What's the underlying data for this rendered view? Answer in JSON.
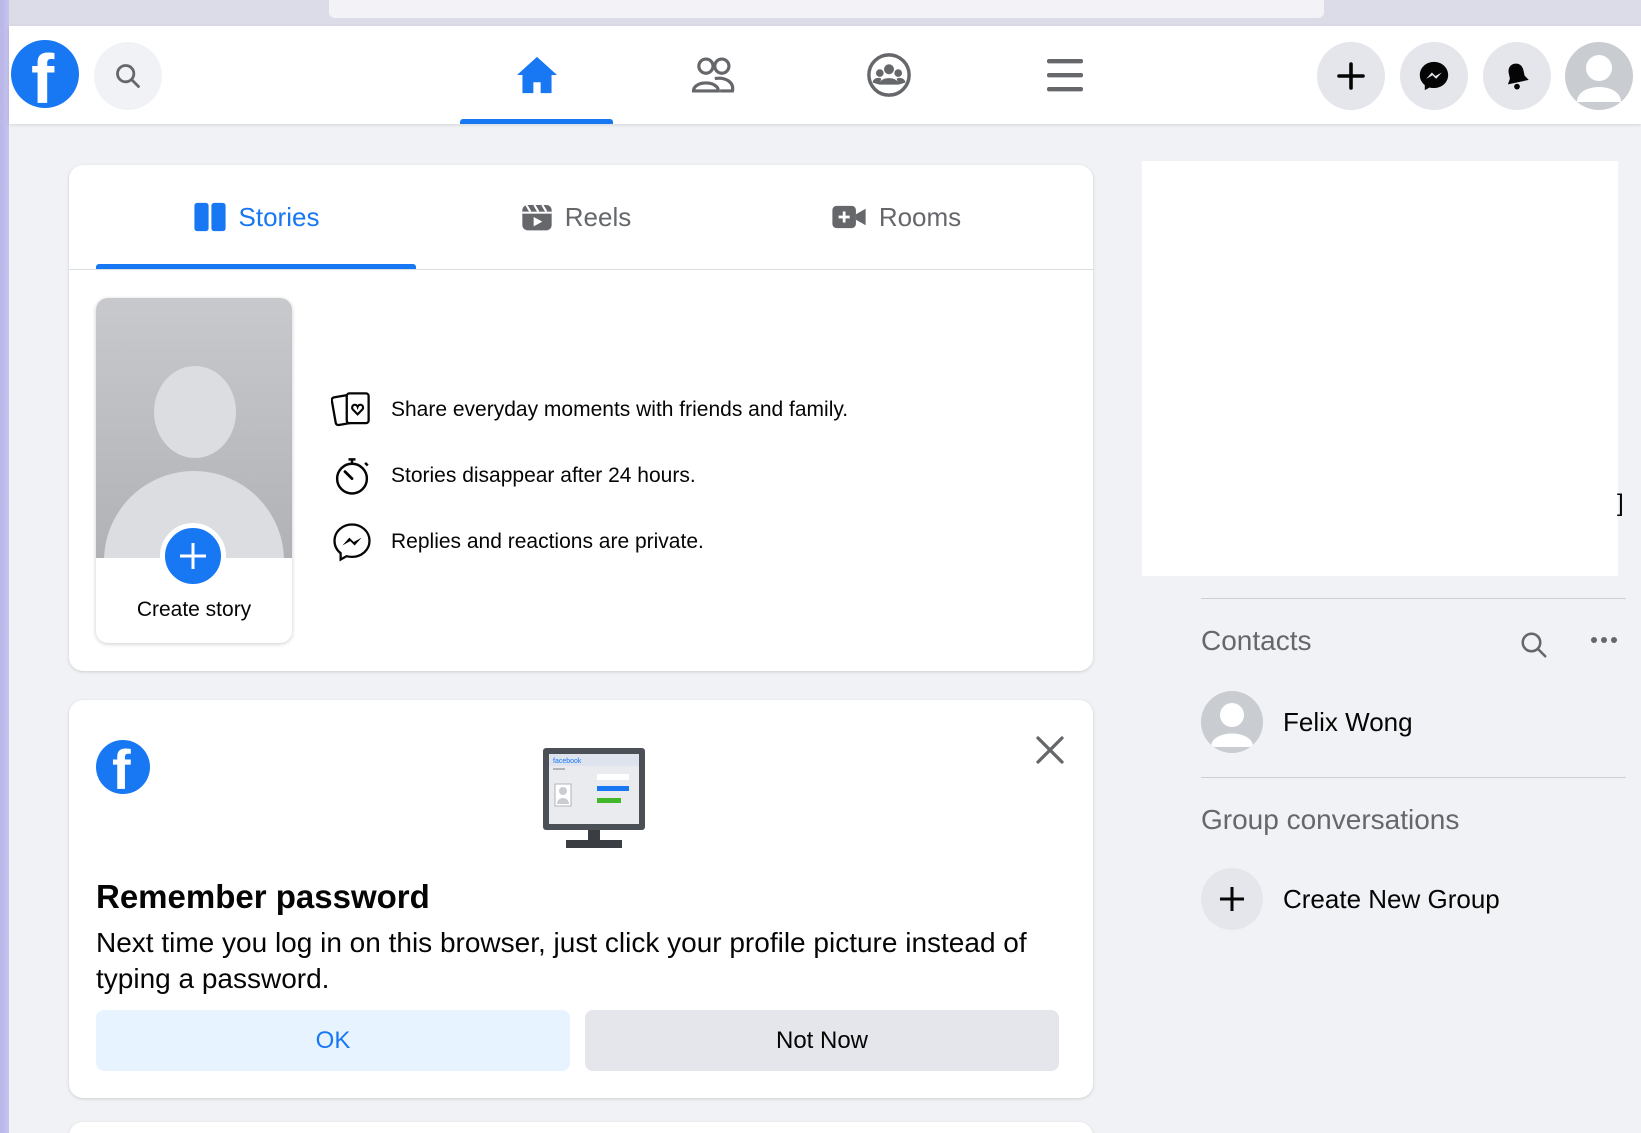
{
  "header": {
    "logo_letter": "f",
    "nav": [
      {
        "name": "home",
        "icon": "home-icon",
        "active": true
      },
      {
        "name": "friends",
        "icon": "friends-icon",
        "active": false
      },
      {
        "name": "groups",
        "icon": "groups-icon",
        "active": false
      },
      {
        "name": "menu",
        "icon": "menu-icon",
        "active": false
      }
    ],
    "actions": [
      "plus-icon",
      "messenger-icon",
      "bell-icon",
      "avatar"
    ]
  },
  "stories": {
    "tabs": [
      {
        "label": "Stories",
        "icon": "stories-icon",
        "active": true
      },
      {
        "label": "Reels",
        "icon": "reels-icon",
        "active": false
      },
      {
        "label": "Rooms",
        "icon": "rooms-icon",
        "active": false
      }
    ],
    "create_label": "Create story",
    "info": [
      {
        "icon": "cards-heart-icon",
        "text": "Share everyday moments with friends and family."
      },
      {
        "icon": "timer-icon",
        "text": "Stories disappear after 24 hours."
      },
      {
        "icon": "messenger-icon",
        "text": "Replies and reactions are private."
      }
    ]
  },
  "remember": {
    "logo_letter": "f",
    "title": "Remember password",
    "text": "Next time you log in on this browser, just click your profile picture instead of typing a password.",
    "ok_label": "OK",
    "not_now_label": "Not Now",
    "monitor_brand": "facebook"
  },
  "sidebar": {
    "bracket": "]",
    "contacts_title": "Contacts",
    "contacts": [
      {
        "name": "Felix Wong"
      }
    ],
    "groups_title": "Group conversations",
    "create_group_label": "Create New Group"
  },
  "colors": {
    "brand": "#1877f2",
    "secondary_text": "#65676b",
    "background": "#f0f2f5"
  }
}
